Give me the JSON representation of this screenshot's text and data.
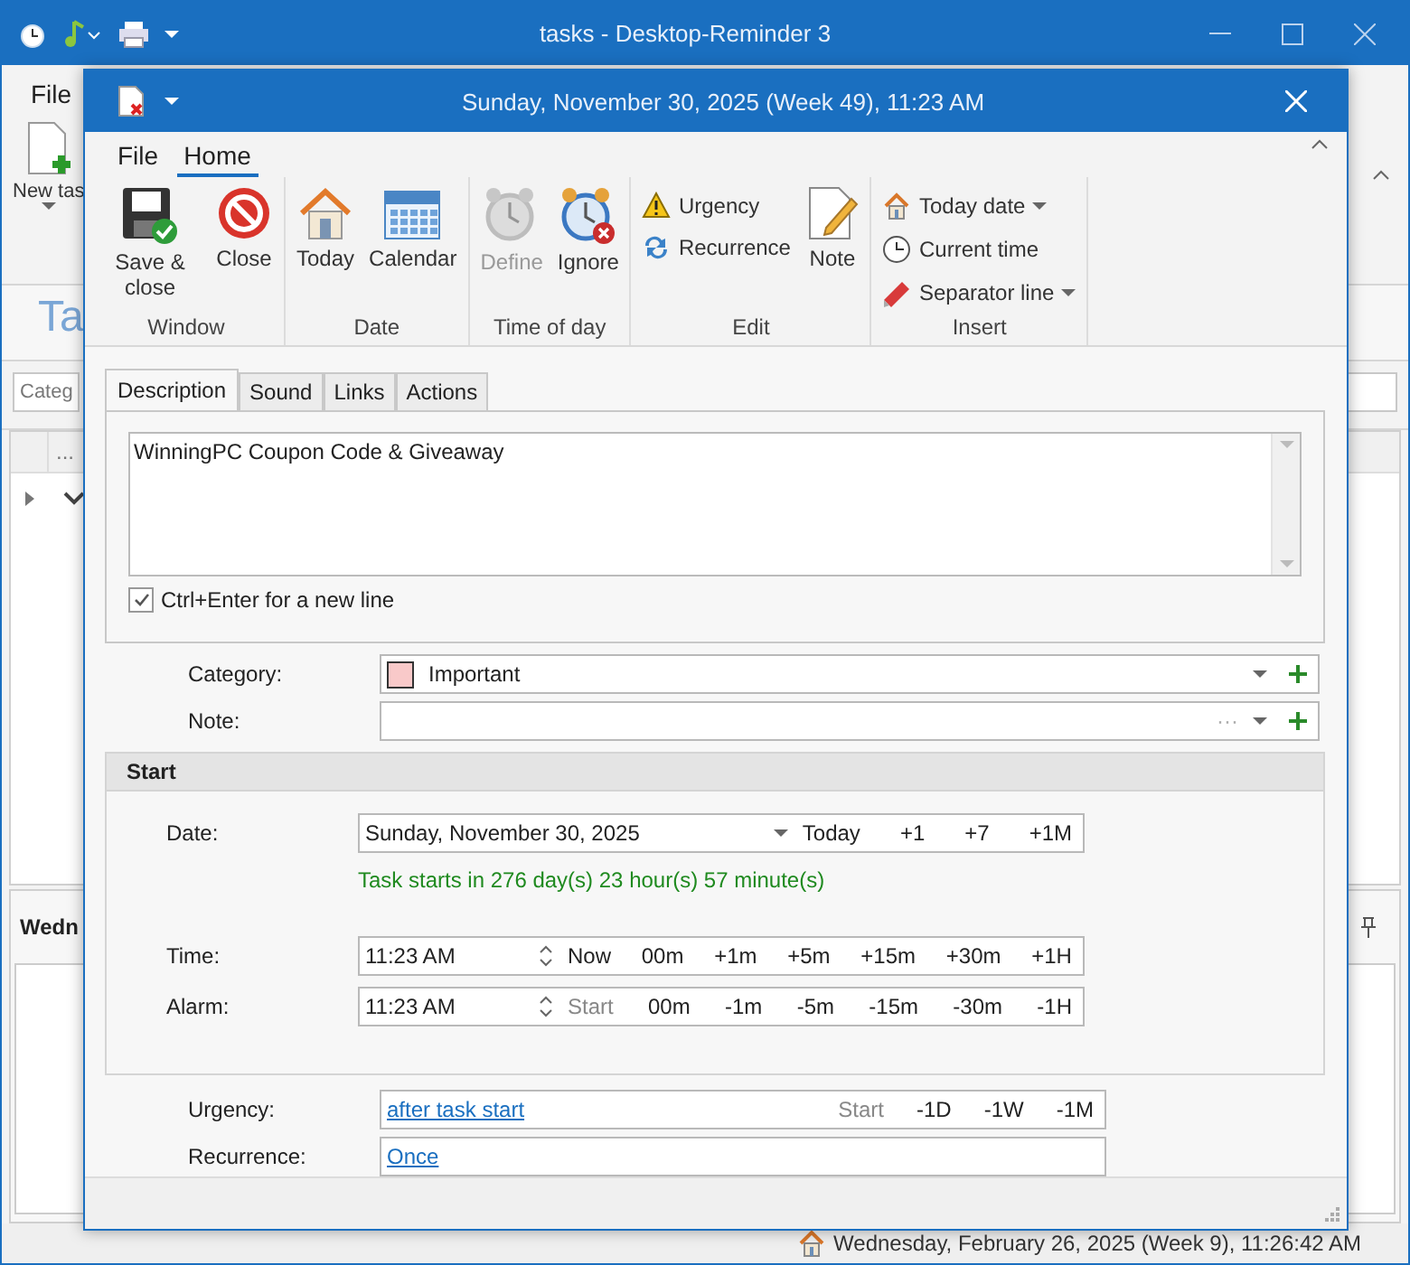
{
  "main_window": {
    "title": "tasks - Desktop-Reminder 3",
    "ribbon_tab": "File",
    "new_task_label": "New tas",
    "view_title": "Ta",
    "filter_text": "Categ",
    "grid_column_1": "...",
    "panel_header": "Wedn",
    "status_bar": "Wednesday, February 26, 2025 (Week 9), 11:26:42 AM"
  },
  "dialog": {
    "title": "Sunday, November 30, 2025 (Week 49), 11:23 AM",
    "ribbon_tabs": [
      {
        "label": "File",
        "selected": false
      },
      {
        "label": "Home",
        "selected": true
      }
    ],
    "ribbon_groups": [
      {
        "label": "Window",
        "buttons": [
          {
            "label": "Save & close",
            "kind": "save",
            "disabled": false,
            "menu": false
          },
          {
            "label": "Close",
            "kind": "close",
            "disabled": false,
            "menu": false
          }
        ]
      },
      {
        "label": "Date",
        "buttons": [
          {
            "label": "Today",
            "kind": "today",
            "disabled": false,
            "menu": false
          },
          {
            "label": "Calendar",
            "kind": "calendar",
            "disabled": false,
            "menu": false
          }
        ]
      },
      {
        "label": "Time of day",
        "buttons": [
          {
            "label": "Define",
            "kind": "define",
            "disabled": true,
            "menu": false
          },
          {
            "label": "Ignore",
            "kind": "ignore",
            "disabled": false,
            "menu": false
          }
        ]
      },
      {
        "label": "Edit",
        "buttons": [
          {
            "label": "Urgency",
            "kind": "urgency",
            "disabled": false,
            "menu": false
          },
          {
            "label": "Recurrence",
            "kind": "recurrence",
            "disabled": false,
            "menu": false
          },
          {
            "label": "Note",
            "kind": "note",
            "disabled": false,
            "menu": false
          }
        ]
      },
      {
        "label": "Insert",
        "buttons": [
          {
            "label": "Today date",
            "kind": "today_date",
            "disabled": false,
            "menu": true
          },
          {
            "label": "Current time",
            "kind": "current_time",
            "disabled": false,
            "menu": false
          },
          {
            "label": "Separator line",
            "kind": "separator",
            "disabled": false,
            "menu": true
          }
        ]
      }
    ],
    "tabs": [
      {
        "label": "Description",
        "selected": true
      },
      {
        "label": "Sound",
        "selected": false
      },
      {
        "label": "Links",
        "selected": false
      },
      {
        "label": "Actions",
        "selected": false
      }
    ],
    "description": "WinningPC Coupon Code & Giveaway",
    "ctrl_enter": {
      "label": "Ctrl+Enter for a new line",
      "checked": true
    },
    "category": {
      "label": "Category:",
      "value": "Important",
      "color": "#f9c9c9"
    },
    "note": {
      "label": "Note:",
      "more": "···"
    },
    "start": {
      "title": "Start",
      "date": {
        "label": "Date:",
        "value": "Sunday, November 30, 2025",
        "shortcuts": [
          {
            "label": "Today",
            "disabled": false
          },
          {
            "label": "+1",
            "disabled": false
          },
          {
            "label": "+7",
            "disabled": false
          },
          {
            "label": "+1M",
            "disabled": false
          }
        ]
      },
      "info": "Task starts in 276 day(s) 23 hour(s) 57 minute(s)",
      "time": {
        "label": "Time:",
        "value": "11:23 AM",
        "shortcuts": [
          {
            "label": "Now",
            "disabled": false
          },
          {
            "label": "00m",
            "disabled": false
          },
          {
            "label": "+1m",
            "disabled": false
          },
          {
            "label": "+5m",
            "disabled": false
          },
          {
            "label": "+15m",
            "disabled": false
          },
          {
            "label": "+30m",
            "disabled": false
          },
          {
            "label": "+1H",
            "disabled": false
          }
        ]
      },
      "alarm": {
        "label": "Alarm:",
        "value": "11:23 AM",
        "shortcuts": [
          {
            "label": "Start",
            "disabled": true
          },
          {
            "label": "00m",
            "disabled": false
          },
          {
            "label": "-1m",
            "disabled": false
          },
          {
            "label": "-5m",
            "disabled": false
          },
          {
            "label": "-15m",
            "disabled": false
          },
          {
            "label": "-30m",
            "disabled": false
          },
          {
            "label": "-1H",
            "disabled": false
          }
        ]
      }
    },
    "urgency": {
      "label": "Urgency:",
      "link": "after task start",
      "shortcuts": [
        {
          "label": "Start",
          "disabled": true
        },
        {
          "label": "-1D",
          "disabled": false
        },
        {
          "label": "-1W",
          "disabled": false
        },
        {
          "label": "-1M",
          "disabled": false
        }
      ]
    },
    "recurrence": {
      "label": "Recurrence:",
      "link": "Once"
    }
  }
}
